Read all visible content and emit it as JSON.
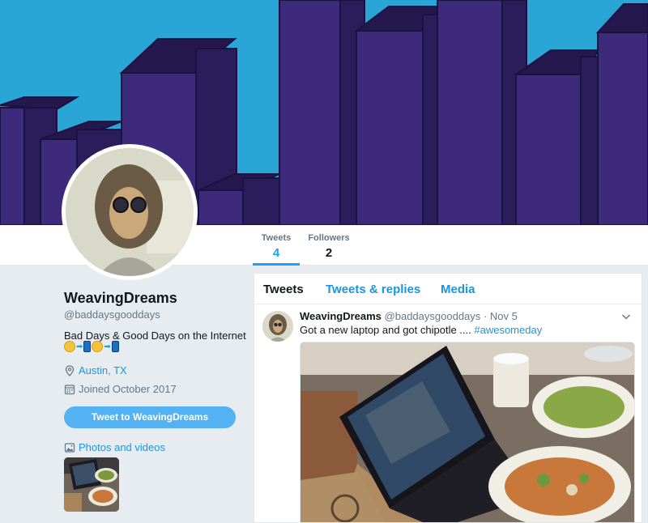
{
  "profile": {
    "display_name": "WeavingDreams",
    "handle": "@baddaysgooddays",
    "bio": "Bad Days & Good Days on the Internet",
    "location": "Austin, TX",
    "joined": "Joined October 2017",
    "tweet_to_label": "Tweet to WeavingDreams",
    "photos_videos_label": "Photos and videos"
  },
  "stats": {
    "tweets_label": "Tweets",
    "tweets_count": "4",
    "followers_label": "Followers",
    "followers_count": "2"
  },
  "timeline": {
    "tabs": [
      {
        "label": "Tweets"
      },
      {
        "label": "Tweets & replies"
      },
      {
        "label": "Media"
      }
    ],
    "tweet": {
      "name": "WeavingDreams",
      "handle": "@baddaysgooddays",
      "date": "Nov 5",
      "text": "Got a new laptop and got chipotle .... ",
      "hashtag": "#awesomeday",
      "separator": " · "
    }
  },
  "colors": {
    "accent": "#1da1f2",
    "link": "#1b95e0",
    "banner_sky": "#2aa6d6",
    "building": "#3d2a7a",
    "page_bg": "#e6ecf0"
  },
  "icons": {
    "location": "location-pin-icon",
    "calendar": "calendar-icon",
    "photo": "photo-icon",
    "caret": "chevron-down-icon"
  }
}
